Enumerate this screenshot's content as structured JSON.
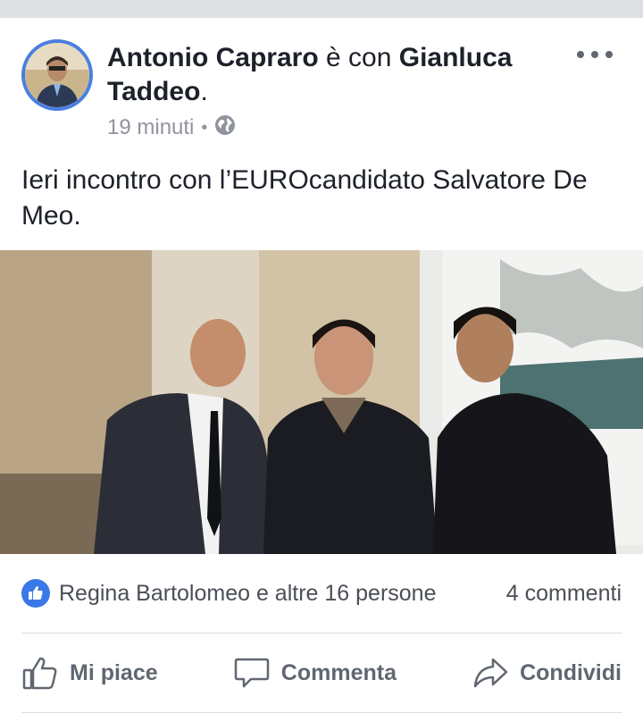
{
  "post": {
    "author": "Antonio Capraro",
    "with_word": "è con",
    "tagged_first": "Gianluca",
    "tagged_last": "Taddeo",
    "period": ".",
    "time": "19 minuti",
    "separator": "•",
    "privacy_icon": "globe-icon",
    "text": "Ieri incontro con l’EUROcandidato Salvatore De Meo."
  },
  "reactions": {
    "icon": "like-icon",
    "summary": "Regina Bartolomeo e altre 16 persone",
    "comments": "4 commenti"
  },
  "actions": {
    "like_label": "Mi piace",
    "comment_label": "Commenta",
    "share_label": "Condividi"
  },
  "colors": {
    "background": "#dddfe2",
    "card": "#ffffff",
    "text": "#1d2129",
    "secondary_text": "#90949c",
    "action_text": "#606770",
    "like_blue": "#3b78e7",
    "avatar_ring": "#4a7fe0"
  }
}
